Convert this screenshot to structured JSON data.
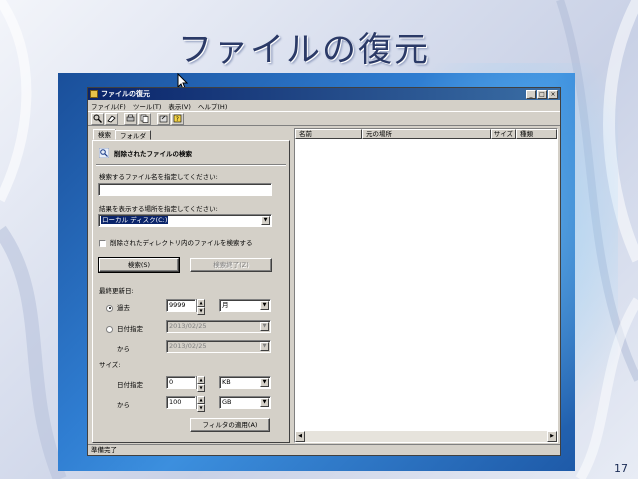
{
  "slide": {
    "title": "ファイルの復元",
    "page_number": "17"
  },
  "window": {
    "title": "ファイルの復元",
    "controls": {
      "minimize": "_",
      "maximize": "□",
      "close": "×"
    },
    "menu": [
      "ファイル(F)",
      "ツール(T)",
      "表示(V)",
      "ヘルプ(H)"
    ],
    "toolbar_icons": [
      "search-icon",
      "eraser-icon",
      "print-icon",
      "copy-icon",
      "export-icon",
      "help-icon"
    ]
  },
  "tabs": [
    "検索",
    "フォルダ"
  ],
  "search": {
    "section_title": "削除されたファイルの検索",
    "filename_label": "検索するファイル名を指定してください:",
    "filename_value": "",
    "location_label": "結果を表示する場所を指定してください:",
    "location_value": "ローカル ディスク(C:)",
    "subdir_checkbox_label": "削除されたディレクトリ内のファイルを検索する",
    "search_button": "検索(S)",
    "stop_button": "検索終了(Z)",
    "last_modified_label": "最終更新日:",
    "past_radio_label": "過去",
    "past_value": "9999",
    "past_unit": "月",
    "date_radio_label": "日付指定",
    "date_from_value": "2013/02/25",
    "from_label": "から",
    "date_to_value": "2013/02/25",
    "size_label": "サイズ:",
    "size_specify_label": "日付指定",
    "size_min_value": "0",
    "size_min_unit": "KB",
    "size_from_label": "から",
    "size_max_value": "100",
    "size_max_unit": "GB",
    "apply_filter_button": "フィルタの適用(A)"
  },
  "results": {
    "columns": [
      "名前",
      "元の場所",
      "サイズ",
      "種類"
    ]
  },
  "status": "準備完了"
}
